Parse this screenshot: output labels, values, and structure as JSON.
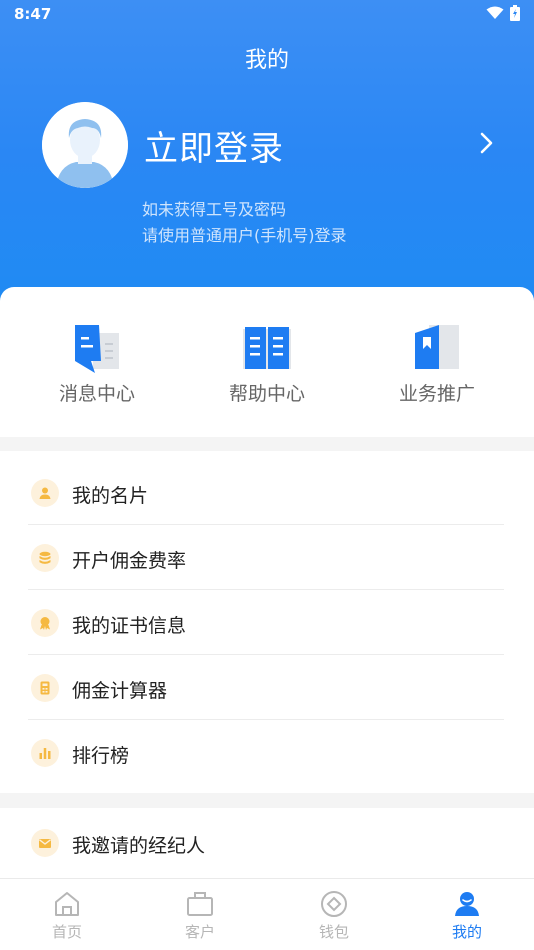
{
  "status_bar": {
    "time": "8:47"
  },
  "header": {
    "title": "我的",
    "login_title": "立即登录",
    "hint_line1": "如未获得工号及密码",
    "hint_line2": "请使用普通用户(手机号)登录"
  },
  "quick_actions": [
    {
      "label": "消息中心",
      "icon": "message-doc-icon"
    },
    {
      "label": "帮助中心",
      "icon": "book-icon"
    },
    {
      "label": "业务推广",
      "icon": "bookmark-icon"
    }
  ],
  "menu": [
    {
      "label": "我的名片",
      "icon": "user-card-icon"
    },
    {
      "label": "开户佣金费率",
      "icon": "coins-icon"
    },
    {
      "label": "我的证书信息",
      "icon": "certificate-icon"
    },
    {
      "label": "佣金计算器",
      "icon": "calculator-icon"
    },
    {
      "label": "排行榜",
      "icon": "ranking-icon"
    }
  ],
  "menu2": [
    {
      "label": "我邀请的经纪人",
      "icon": "envelope-icon"
    }
  ],
  "tabbar": [
    {
      "label": "首页",
      "icon": "home-icon",
      "active": false
    },
    {
      "label": "客户",
      "icon": "briefcase-icon",
      "active": false
    },
    {
      "label": "钱包",
      "icon": "wallet-icon",
      "active": false
    },
    {
      "label": "我的",
      "icon": "profile-icon",
      "active": true
    }
  ],
  "colors": {
    "primary": "#1e7cf2",
    "header_gradient_top": "#3d8ff4",
    "menu_icon_bg": "#fdf1dc",
    "menu_icon_fg": "#f5b942"
  }
}
